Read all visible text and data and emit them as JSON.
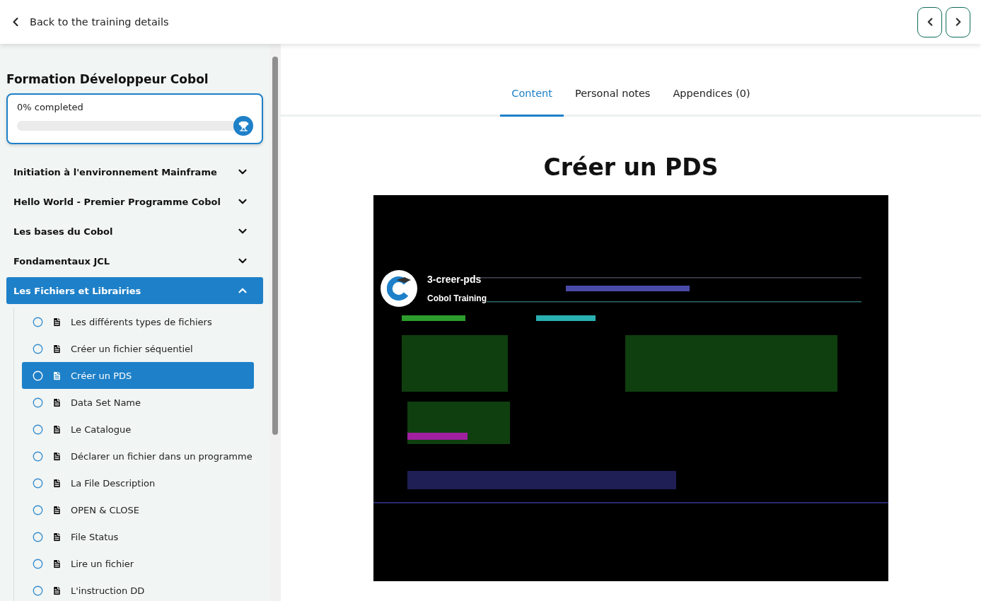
{
  "header": {
    "back_label": "Back to the training details"
  },
  "sidebar": {
    "title": "Formation Développeur Cobol",
    "progress": {
      "label": "0% completed",
      "level": 0
    },
    "sections": [
      {
        "title": "Initiation à l'environnement Mainframe",
        "expanded": false,
        "selected": false
      },
      {
        "title": "Hello World - Premier Programme Cobol",
        "expanded": false,
        "selected": false
      },
      {
        "title": "Les bases du Cobol",
        "expanded": false,
        "selected": false
      },
      {
        "title": "Fondamentaux JCL",
        "expanded": false,
        "selected": false
      },
      {
        "title": "Les Fichiers et Librairies",
        "expanded": true,
        "selected": true,
        "children": [
          {
            "label": "Les différents types de fichiers",
            "selected": false,
            "checked": false
          },
          {
            "label": "Créer un fichier séquentiel",
            "selected": false,
            "checked": false
          },
          {
            "label": "Créer un PDS",
            "selected": true,
            "checked": false
          },
          {
            "label": "Data Set Name",
            "selected": false,
            "checked": false
          },
          {
            "label": "Le Catalogue",
            "selected": false,
            "checked": false
          },
          {
            "label": "Déclarer un fichier dans un programme",
            "selected": false,
            "checked": false
          },
          {
            "label": "La File Description",
            "selected": false,
            "checked": false
          },
          {
            "label": "OPEN & CLOSE",
            "selected": false,
            "checked": false
          },
          {
            "label": "File Status",
            "selected": false,
            "checked": false
          },
          {
            "label": "Lire un fichier",
            "selected": false,
            "checked": false
          },
          {
            "label": "L'instruction DD",
            "selected": false,
            "checked": false
          }
        ]
      }
    ]
  },
  "tabs": [
    {
      "label": "Content",
      "selected": true
    },
    {
      "label": "Personal notes",
      "selected": false
    },
    {
      "label": "Appendices (0)",
      "selected": false
    }
  ],
  "content": {
    "title": "Créer un PDS",
    "video": {
      "kind": "picture",
      "title": "3-creer-pds",
      "channel": "Cobol Training"
    }
  }
}
